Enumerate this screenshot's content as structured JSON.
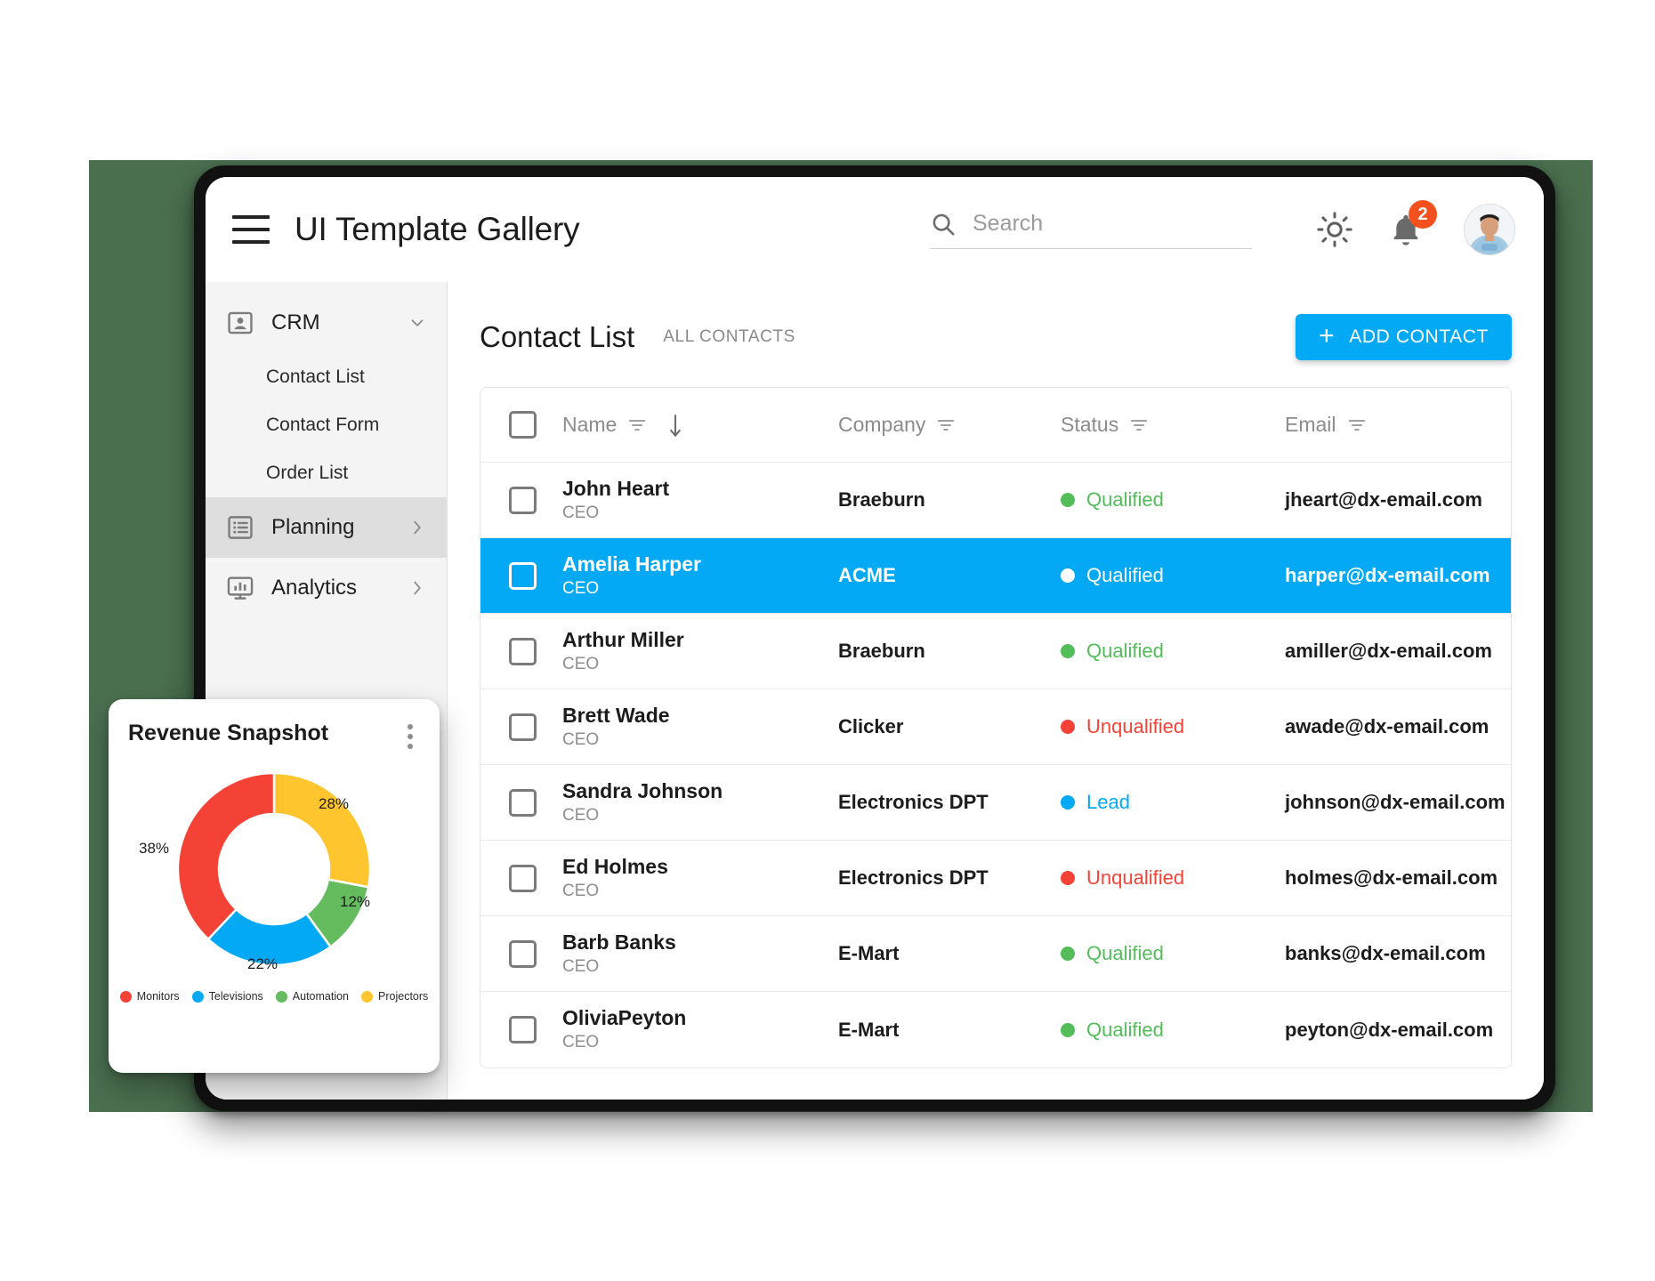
{
  "appbar": {
    "title": "UI Template Gallery",
    "search_placeholder": "Search",
    "search_value": "",
    "notification_count": "2"
  },
  "sidebar": {
    "groups": [
      {
        "label": "CRM",
        "icon": "contact-card-icon",
        "expanded": true,
        "chevron": "chevron-down",
        "children": [
          "Contact List",
          "Contact Form",
          "Order List"
        ]
      },
      {
        "label": "Planning",
        "icon": "list-icon",
        "expanded": false,
        "chevron": "chevron-right",
        "active": true,
        "children": []
      },
      {
        "label": "Analytics",
        "icon": "monitor-chart-icon",
        "expanded": false,
        "chevron": "chevron-right",
        "children": []
      }
    ]
  },
  "main": {
    "title": "Contact List",
    "subtitle": "ALL CONTACTS",
    "add_button": "ADD CONTACT",
    "columns": [
      "Name",
      "Company",
      "Status",
      "Email"
    ],
    "sorted_column": "Name",
    "sort_direction": "descending",
    "rows": [
      {
        "name": "John Heart",
        "role": "CEO",
        "company": "Braeburn",
        "status": "Qualified",
        "status_color": "#52bd59",
        "email": "jheart@dx-email.com",
        "selected": false,
        "checked": false
      },
      {
        "name": "Amelia Harper",
        "role": "CEO",
        "company": "ACME",
        "status": "Qualified",
        "status_color": "#ffffff",
        "email": "harper@dx-email.com",
        "selected": true,
        "checked": false
      },
      {
        "name": "Arthur Miller",
        "role": "CEO",
        "company": "Braeburn",
        "status": "Qualified",
        "status_color": "#52bd59",
        "email": "amiller@dx-email.com",
        "selected": false,
        "checked": false
      },
      {
        "name": "Brett Wade",
        "role": "CEO",
        "company": "Clicker",
        "status": "Unqualified",
        "status_color": "#f44336",
        "email": "awade@dx-email.com",
        "selected": false,
        "checked": false
      },
      {
        "name": "Sandra Johnson",
        "role": "CEO",
        "company": "Electronics DPT",
        "status": "Lead",
        "status_color": "#03a9f4",
        "email": "johnson@dx-email.com",
        "selected": false,
        "checked": false
      },
      {
        "name": "Ed Holmes",
        "role": "CEO",
        "company": "Electronics DPT",
        "status": "Unqualified",
        "status_color": "#f44336",
        "email": "holmes@dx-email.com",
        "selected": false,
        "checked": false
      },
      {
        "name": "Barb Banks",
        "role": "CEO",
        "company": "E-Mart",
        "status": "Qualified",
        "status_color": "#52bd59",
        "email": "banks@dx-email.com",
        "selected": false,
        "checked": false
      },
      {
        "name": "OliviaPeyton",
        "role": "CEO",
        "company": "E-Mart",
        "status": "Qualified",
        "status_color": "#52bd59",
        "email": "peyton@dx-email.com",
        "selected": false,
        "checked": false
      }
    ]
  },
  "chart_data": {
    "type": "pie",
    "title": "Revenue Snapshot",
    "subtype": "donut",
    "categories": [
      "Monitors",
      "Televisions",
      "Automation",
      "Projectors"
    ],
    "values": [
      38,
      22,
      12,
      28
    ],
    "labels": [
      "38%",
      "22%",
      "12%",
      "28%"
    ],
    "colors": [
      "#f44336",
      "#03a9f4",
      "#64bc5e",
      "#fec52e"
    ],
    "legend_position": "bottom",
    "menu_icon": "kebab-menu-icon"
  },
  "colors": {
    "accent": "#03a9f4",
    "backdrop": "#4b7050",
    "badge": "#f4511e",
    "qualified": "#52bd59",
    "unqualified": "#f44336",
    "lead": "#03a9f4"
  }
}
